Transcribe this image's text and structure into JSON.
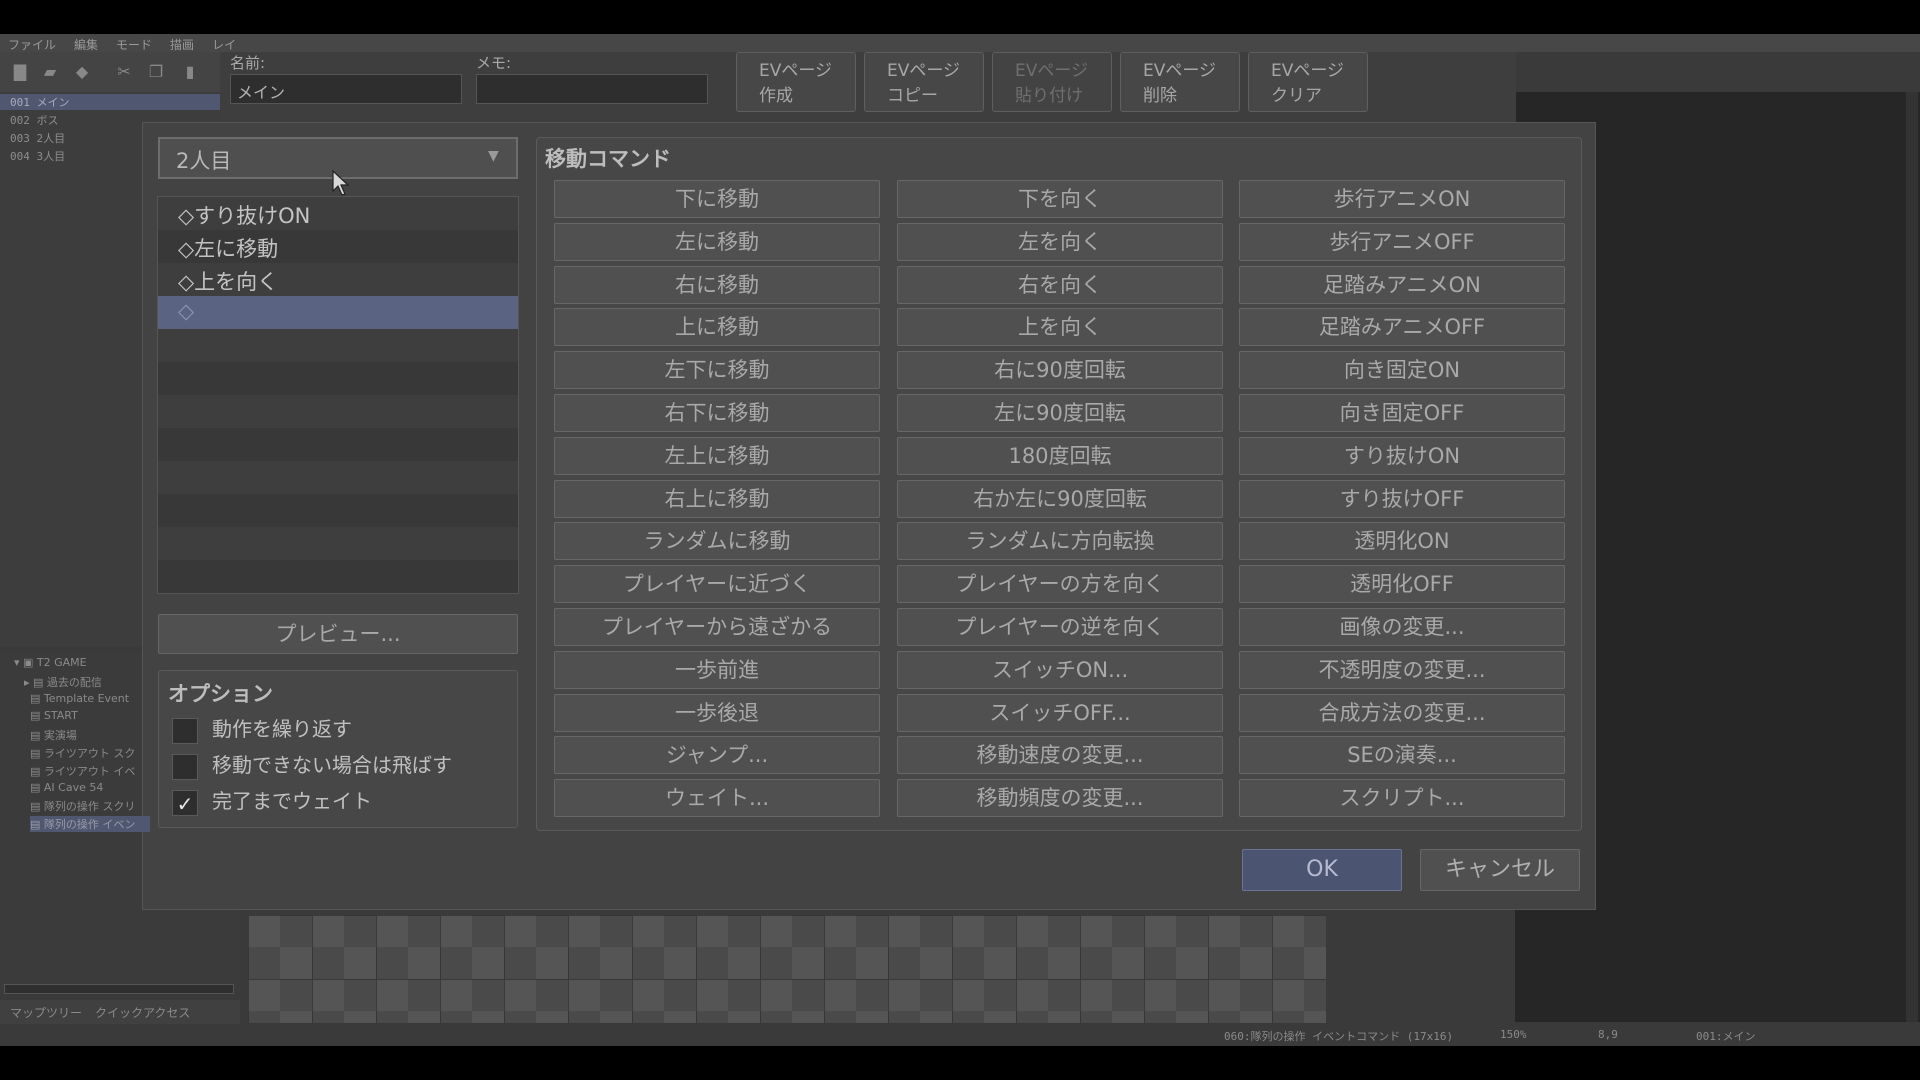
{
  "menubar": [
    "ファイル",
    "編集",
    "モード",
    "描画",
    "レイ"
  ],
  "map_list": [
    {
      "label": "001 メイン",
      "selected": true
    },
    {
      "label": "002 ボス",
      "selected": false
    },
    {
      "label": "003 2人目",
      "selected": false
    },
    {
      "label": "004 3人目",
      "selected": false
    }
  ],
  "tree": [
    "T2 GAME",
    "過去の配信",
    "Template Event",
    "START",
    "実演場",
    "ライツアウト スク",
    "ライツアウト イベ",
    "AI Cave 54",
    "隊列の操作 スクリ",
    "隊列の操作 イベン"
  ],
  "bottom_tabs": [
    "マップツリー",
    "クイックアクセス"
  ],
  "statusbar": {
    "event": "060:隊列の操作 イベントコマンド (17x16)",
    "zoom": "150%",
    "coords": "8,9",
    "map": "001:メイン"
  },
  "header": {
    "name_label": "名前:",
    "name_value": "メイン",
    "memo_label": "メモ:",
    "memo_value": "",
    "ev_buttons": [
      {
        "label": "EVページ\n作成",
        "disabled": false
      },
      {
        "label": "EVページ\nコピー",
        "disabled": false
      },
      {
        "label": "EVページ\n貼り付け",
        "disabled": true
      },
      {
        "label": "EVページ\n削除",
        "disabled": false
      },
      {
        "label": "EVページ\nクリア",
        "disabled": false
      }
    ]
  },
  "dialog": {
    "target_selected": "2人目",
    "command_list": [
      {
        "label": "◇すり抜けON",
        "selected": false
      },
      {
        "label": "◇左に移動",
        "selected": false
      },
      {
        "label": "◇上を向く",
        "selected": false
      },
      {
        "label": "◇",
        "selected": true
      }
    ],
    "preview_label": "プレビュー...",
    "options_title": "オプション",
    "options": [
      {
        "label": "動作を繰り返す",
        "checked": false
      },
      {
        "label": "移動できない場合は飛ばす",
        "checked": false
      },
      {
        "label": "完了までウェイト",
        "checked": true
      }
    ],
    "move_title": "移動コマンド",
    "move_columns": [
      [
        "下に移動",
        "左に移動",
        "右に移動",
        "上に移動",
        "左下に移動",
        "右下に移動",
        "左上に移動",
        "右上に移動",
        "ランダムに移動",
        "プレイヤーに近づく",
        "プレイヤーから遠ざかる",
        "一歩前進",
        "一歩後退",
        "ジャンプ...",
        "ウェイト..."
      ],
      [
        "下を向く",
        "左を向く",
        "右を向く",
        "上を向く",
        "右に90度回転",
        "左に90度回転",
        "180度回転",
        "右か左に90度回転",
        "ランダムに方向転換",
        "プレイヤーの方を向く",
        "プレイヤーの逆を向く",
        "スイッチON...",
        "スイッチOFF...",
        "移動速度の変更...",
        "移動頻度の変更..."
      ],
      [
        "歩行アニメON",
        "歩行アニメOFF",
        "足踏みアニメON",
        "足踏みアニメOFF",
        "向き固定ON",
        "向き固定OFF",
        "すり抜けON",
        "すり抜けOFF",
        "透明化ON",
        "透明化OFF",
        "画像の変更...",
        "不透明度の変更...",
        "合成方法の変更...",
        "SEの演奏...",
        "スクリプト..."
      ]
    ],
    "ok_label": "OK",
    "cancel_label": "キャンセル",
    "check_mark": "✓"
  }
}
